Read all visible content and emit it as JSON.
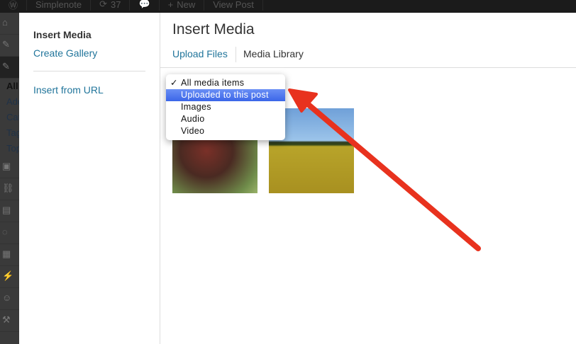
{
  "adminbar": {
    "site": "Simplenote",
    "updates": "37",
    "new": "New",
    "view": "View Post"
  },
  "adminmenu": {
    "submenu": [
      "All",
      "Add",
      "Cat",
      "Tag",
      "Top"
    ]
  },
  "sidebar": {
    "items": [
      "Insert Media",
      "Create Gallery",
      "Insert from URL"
    ]
  },
  "header": {
    "title": "Insert Media",
    "tabs": [
      "Upload Files",
      "Media Library"
    ]
  },
  "filter": {
    "options": [
      "All media items",
      "Uploaded to this post",
      "Images",
      "Audio",
      "Video"
    ],
    "selected": "All media items",
    "highlighted": "Uploaded to this post",
    "check": "✓"
  },
  "colors": {
    "link": "#21759b",
    "highlight": "#3b66e8",
    "arrow": "#e8321e"
  }
}
